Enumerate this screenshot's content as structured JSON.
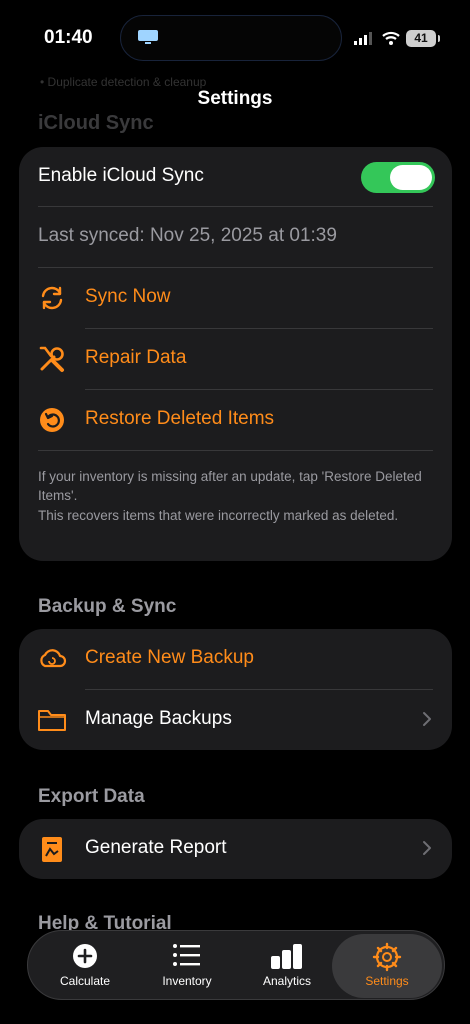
{
  "status_bar": {
    "time": "01:40",
    "battery": "41"
  },
  "nav": {
    "title": "Settings",
    "ghost_text": "• Duplicate detection & cleanup",
    "ghost_section": "iCloud Sync"
  },
  "icloud": {
    "enable_label": "Enable iCloud Sync",
    "enabled": true,
    "last_synced": "Last synced: Nov 25, 2025 at 01:39",
    "sync_now": "Sync Now",
    "repair": "Repair Data",
    "restore": "Restore Deleted Items",
    "note1": "If your inventory is missing after an update, tap 'Restore Deleted Items'.",
    "note2": "This recovers items that were incorrectly marked as deleted."
  },
  "backup": {
    "heading": "Backup & Sync",
    "create": "Create New Backup",
    "manage": "Manage Backups"
  },
  "export": {
    "heading": "Export Data",
    "report": "Generate Report"
  },
  "help": {
    "heading": "Help & Tutorial"
  },
  "tabs": [
    {
      "label": "Calculate",
      "icon": "plus-circle-icon"
    },
    {
      "label": "Inventory",
      "icon": "list-icon"
    },
    {
      "label": "Analytics",
      "icon": "bar-chart-icon"
    },
    {
      "label": "Settings",
      "icon": "gear-icon",
      "active": true
    }
  ],
  "colors": {
    "accent": "#ff8c1a",
    "toggle_on": "#34c759",
    "card": "#1c1c1e"
  }
}
